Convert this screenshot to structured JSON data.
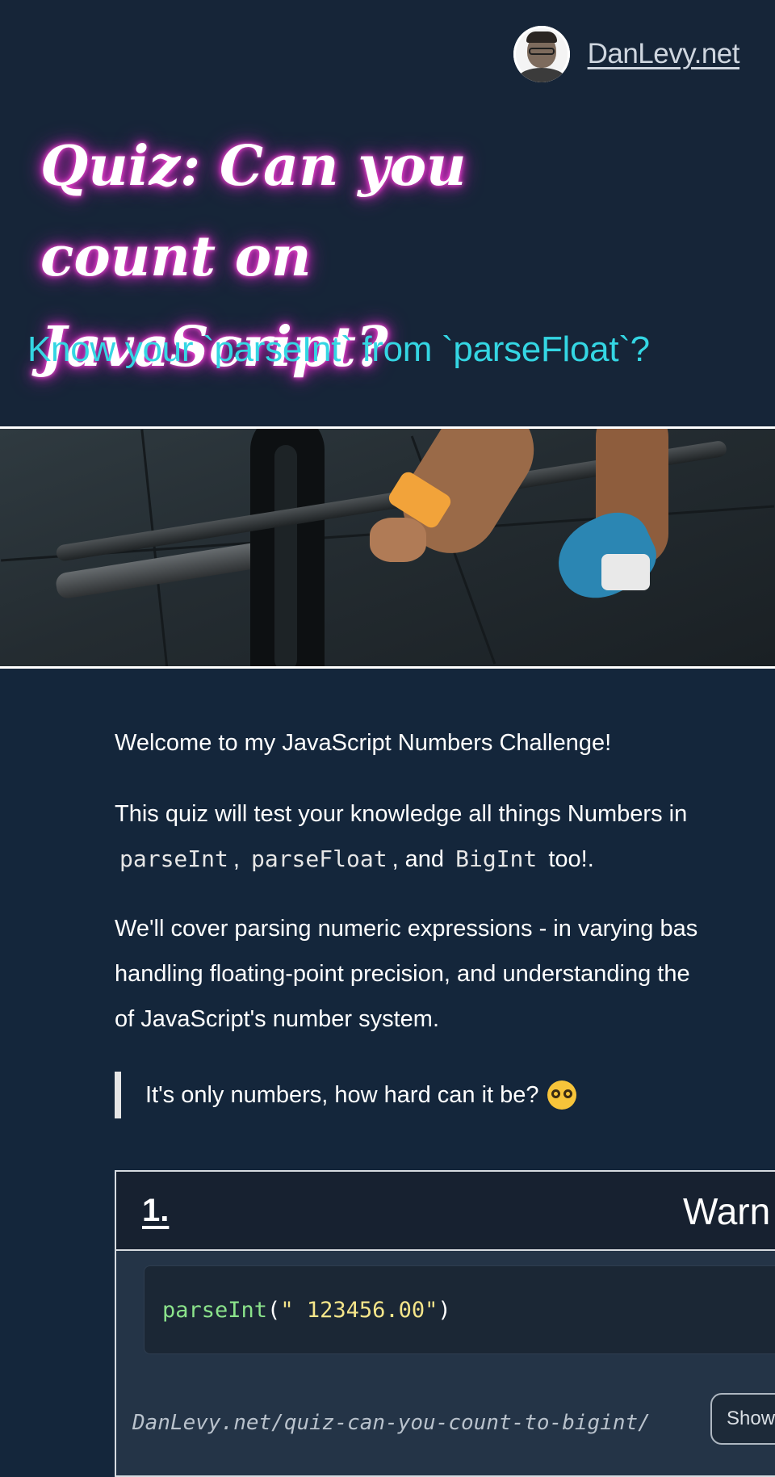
{
  "header": {
    "site_name": "DanLevy.net"
  },
  "hero": {
    "title": "Quiz: Can you count on JavaScript?",
    "subtitle": "Know your `parseInt` from `parseFloat`?"
  },
  "intro": {
    "p1": "Welcome to my JavaScript Numbers Challenge!",
    "p2_text": "This quiz will test your knowledge all things Numbers in",
    "p2_code": [
      "parseInt",
      "parseFloat",
      "BigInt"
    ],
    "p2_sep1": ",",
    "p2_sep2": ", and",
    "p2_tail": "too!.",
    "p3_line1": "We'll cover parsing numeric expressions - in varying bas",
    "p3_line2": "handling floating-point precision, and understanding the",
    "p3_line3": "of JavaScript's number system.",
    "quote": "It's only numbers, how hard can it be?"
  },
  "quiz": {
    "number": "1.",
    "title": "Warn",
    "code_fn": "parseInt",
    "code_open": "(",
    "code_arg": "\" 123456.00\"",
    "code_close": ")",
    "url": "DanLevy.net/quiz-can-you-count-to-bigint/",
    "show_button": "Show"
  },
  "colors": {
    "background": "#14263b",
    "title_glow": "#e22fcf",
    "subtitle": "#34d6e3",
    "code_function": "#8be38b",
    "code_string": "#f5e58a"
  }
}
